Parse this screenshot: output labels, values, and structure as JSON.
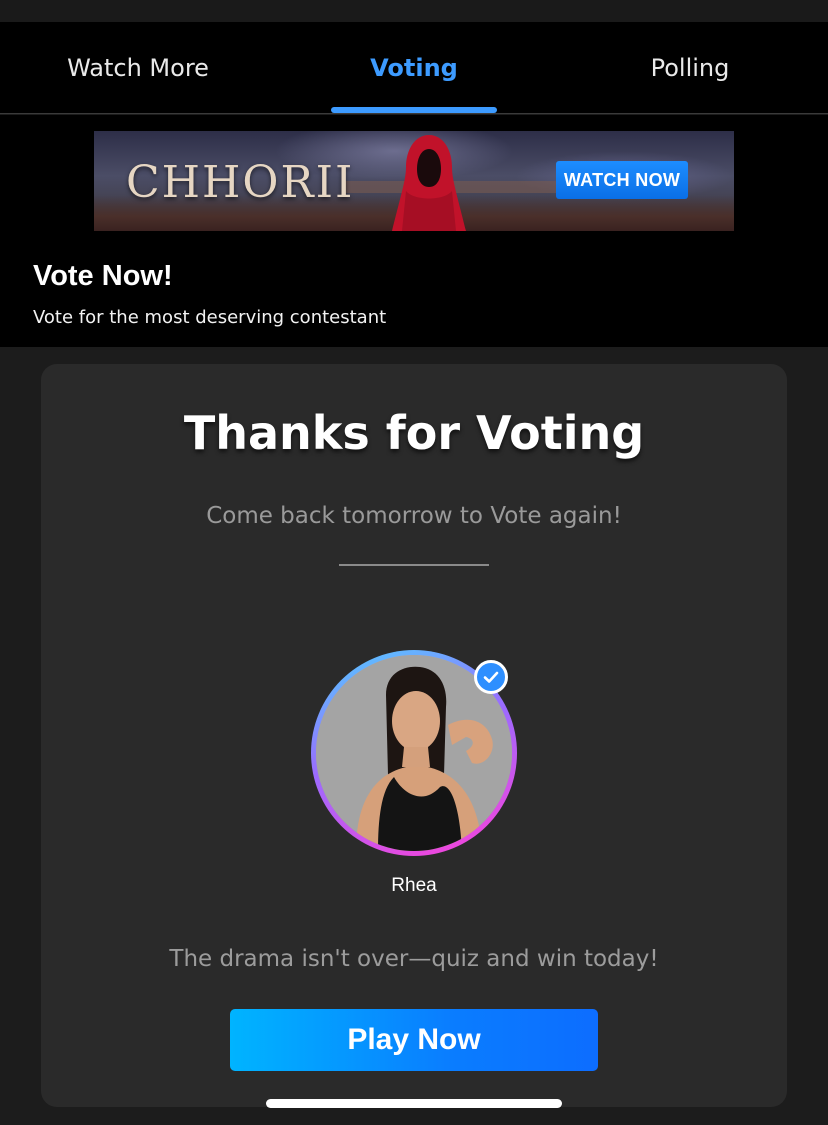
{
  "tabs": [
    {
      "label": "Watch More"
    },
    {
      "label": "Voting"
    },
    {
      "label": "Polling"
    }
  ],
  "banner": {
    "title": "CHHORII",
    "cta_label": "WATCH NOW"
  },
  "header": {
    "title": "Vote Now!",
    "subtitle": "Vote for the most deserving contestant"
  },
  "result": {
    "title": "Thanks for Voting",
    "message": "Come back tomorrow to Vote again!",
    "contestant_name": "Rhea",
    "promo_text": "The drama isn't over—quiz and win today!",
    "play_label": "Play Now"
  },
  "colors": {
    "accent": "#3d9bff",
    "background": "#1c1c1c",
    "card": "#2a2a2a",
    "play_gradient_start": "#00b4ff",
    "play_gradient_end": "#0d6dff",
    "ring_start": "#4fd0ff",
    "ring_end": "#ff3fd6"
  },
  "icons": {
    "selected_badge": "checkmark-icon"
  }
}
